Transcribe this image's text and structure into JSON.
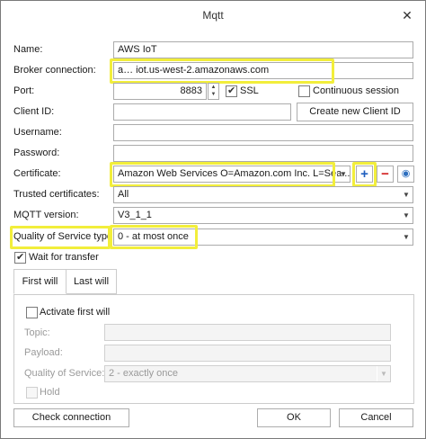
{
  "window": {
    "title": "Mqtt",
    "close_glyph": "✕"
  },
  "form": {
    "name": {
      "label": "Name:",
      "value": "AWS IoT"
    },
    "broker": {
      "label": "Broker connection:",
      "value": "a…                     iot.us-west-2.amazonaws.com"
    },
    "port": {
      "label": "Port:",
      "value": "8883",
      "ssl_label": "SSL",
      "ssl_checked": true,
      "continuous_label": "Continuous session",
      "continuous_checked": false
    },
    "client_id": {
      "label": "Client ID:",
      "value": "",
      "button": "Create new Client ID"
    },
    "username": {
      "label": "Username:",
      "value": ""
    },
    "password": {
      "label": "Password:",
      "value": ""
    },
    "certificate": {
      "label": "Certificate:",
      "value": "Amazon Web Services O=Amazon.com Inc. L=Sea..."
    },
    "trusted": {
      "label": "Trusted certificates:",
      "value": "All"
    },
    "mqtt_version": {
      "label": "MQTT version:",
      "value": "V3_1_1"
    },
    "qos": {
      "label": "Quality of Service type:",
      "value": "0 - at most once"
    },
    "wait_transfer": {
      "label": "Wait for transfer",
      "checked": true
    }
  },
  "tabs": [
    {
      "label": "First will",
      "active": true
    },
    {
      "label": "Last will",
      "active": false
    }
  ],
  "first_will": {
    "activate_label": "Activate first will",
    "topic_label": "Topic:",
    "payload_label": "Payload:",
    "qos_label": "Quality of Service:",
    "qos_value": "2 - exactly once",
    "hold_label": "Hold"
  },
  "footer": {
    "check_connection": "Check connection",
    "ok": "OK",
    "cancel": "Cancel"
  },
  "colors": {
    "highlight": "#f2ee3b",
    "plus": "#1f5fbf",
    "minus": "#d21f1f"
  },
  "icons": {
    "plus": "+",
    "minus": "−",
    "view": "◉",
    "dropdown": "▼"
  }
}
